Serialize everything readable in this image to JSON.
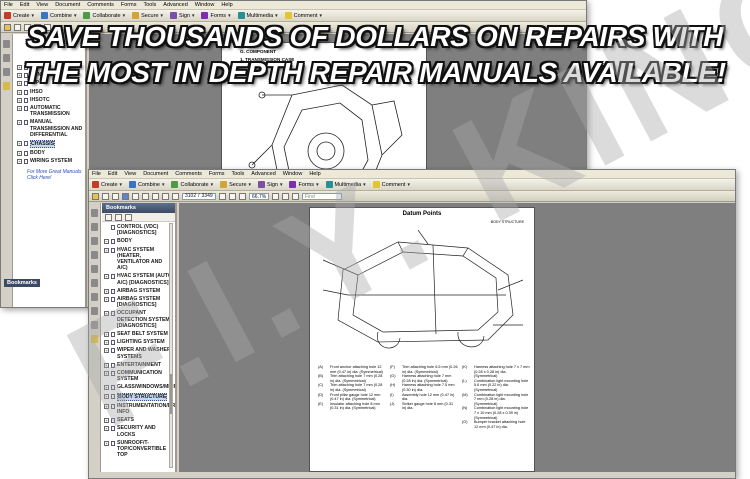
{
  "menu": [
    "File",
    "Edit",
    "View",
    "Document",
    "Comments",
    "Forms",
    "Tools",
    "Advanced",
    "Window",
    "Help"
  ],
  "toolbar": {
    "create": "Create",
    "combine": "Combine",
    "collaborate": "Collaborate",
    "secure": "Secure",
    "sign": "Sign",
    "forms": "Forms",
    "multimedia": "Multimedia",
    "comment": "Comment"
  },
  "back_window": {
    "bookmarks_title": "Bookmarks",
    "bookmarks": [
      {
        "label": "MA",
        "expand": "+"
      },
      {
        "label": "GEN INFO",
        "expand": "+"
      },
      {
        "label": "IMPO",
        "expand": "+"
      },
      {
        "label": "IHSO",
        "expand": "+"
      },
      {
        "label": "IHSOTC",
        "expand": "+"
      },
      {
        "label": "AUTOMATIC TRANSMISSION",
        "expand": "+"
      },
      {
        "label": "MANUAL TRANSMISSION AND DIFFERENTIAL",
        "expand": "+"
      },
      {
        "label": "CHASSIS",
        "expand": "+",
        "selected": true
      },
      {
        "label": "BODY",
        "expand": "+"
      },
      {
        "label": "WIRING SYSTEM",
        "expand": "+"
      }
    ],
    "link_text": "For More Great Manuals Click Here!",
    "page_heading": "G. COMPONENT",
    "page_sub": "1. TRANSMISSION CASE"
  },
  "front_window": {
    "bookmarks_title": "Bookmarks",
    "page_current": "3102",
    "page_total": "3349",
    "zoom": "66.7%",
    "find_placeholder": "Find",
    "bookmarks": [
      {
        "label": "CONTROL (VDC) [DIAGNOSTICS]",
        "expand": ""
      },
      {
        "label": "BODY",
        "expand": "−"
      },
      {
        "label": "HVAC SYSTEM (HEATER, VENTILATOR AND A/C)",
        "expand": "+"
      },
      {
        "label": "HVAC SYSTEM (AUTO A/C) [DIAGNOSTICS]",
        "expand": "+"
      },
      {
        "label": "AIRBAG SYSTEM",
        "expand": "+"
      },
      {
        "label": "AIRBAG SYSTEM [DIAGNOSTICS]",
        "expand": "+"
      },
      {
        "label": "OCCUPANT DETECTION SYSTEM [DIAGNOSTICS]",
        "expand": "+"
      },
      {
        "label": "SEAT BELT SYSTEM",
        "expand": "+"
      },
      {
        "label": "LIGHTING SYSTEM",
        "expand": "+"
      },
      {
        "label": "WIPER AND WASHER SYSTEMS",
        "expand": "+"
      },
      {
        "label": "ENTERTAINMENT",
        "expand": "+"
      },
      {
        "label": "COMMUNICATION SYSTEM",
        "expand": "+"
      },
      {
        "label": "GLASS/WINDOWS/MIRRORS",
        "expand": "+"
      },
      {
        "label": "BODY STRUCTURE",
        "expand": "+",
        "selected": true
      },
      {
        "label": "INSTRUMENTATION/DRIVER INFO",
        "expand": "+"
      },
      {
        "label": "SEATS",
        "expand": "+"
      },
      {
        "label": "SECURITY AND LOCKS",
        "expand": "+"
      },
      {
        "label": "SUNROOF/T-TOP/CONVERTIBLE TOP",
        "expand": "+"
      }
    ],
    "page_title": "Datum Points",
    "page_header_right": "BODY STRUCTURE",
    "legend": [
      [
        "(A)",
        "Front anchor attaching hole 12 mm (0.47 in) dia. (Symmetrical)"
      ],
      [
        "(B)",
        "Trim attaching hole 7 mm (0.28 in) dia. (Symmetrical)"
      ],
      [
        "(C)",
        "Trim attaching hole 7 mm (0.28 in) dia. (Symmetrical)"
      ],
      [
        "(D)",
        "Front pillar gauge hole 12 mm (0.47 in) dia. (Symmetrical)"
      ],
      [
        "(E)",
        "Insulator attaching hole 8 mm (0.31 in) dia. (Symmetrical)"
      ],
      [
        "(F)",
        "Trim attaching hole 6.5 mm (0.26 in) dia. (Symmetrical)"
      ],
      [
        "(G)",
        "Harness attaching hole 7 mm (0.28 in) dia. (Symmetrical)"
      ],
      [
        "(H)",
        "Harness attaching hole 7.5 mm (0.30 in) dia."
      ],
      [
        "(I)",
        "Assembly hole 12 mm (0.47 in) dia."
      ],
      [
        "(J)",
        "Striker gauge hole 8 mm (0.31 in) dia."
      ],
      [
        "(K)",
        "Harness attaching hole 7 x 7 mm (0.28 x 0.28 in) dia. (Symmetrical)"
      ],
      [
        "(L)",
        "Combination light mounting hole 5.6 mm (0.22 in) dia. (Symmetrical)"
      ],
      [
        "(M)",
        "Combination light mounting hole 7 mm (0.28 in) dia. (Symmetrical)"
      ],
      [
        "(N)",
        "Combination light mounting hole 7 x 10 mm (0.28 x 0.39 in) (Symmetrical)"
      ],
      [
        "(O)",
        "Bumper bracket attaching hole 12 mm (0.47 in) dia."
      ]
    ]
  },
  "banner": {
    "line1": "SAVE THOUSANDS OF DOLLARS ON REPAIRS WITH",
    "line2": "THE MOST IN DEPTH REPAIR MANUALS AVAILABLE!"
  },
  "watermark": "F.I.Y. KING"
}
